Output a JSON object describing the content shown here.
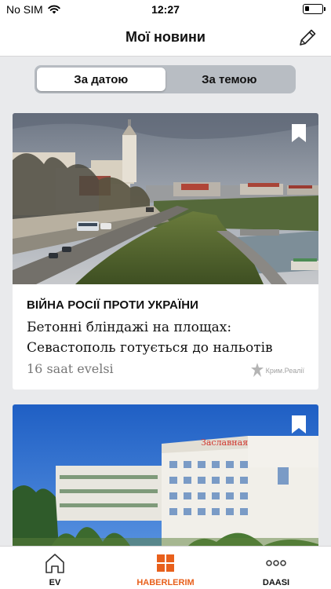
{
  "status_bar": {
    "carrier": "No SIM",
    "time": "12:27"
  },
  "header": {
    "title": "Мої новини",
    "edit_icon": "pencil-icon"
  },
  "segmented": {
    "options": [
      "За датою",
      "За темою"
    ],
    "selected": "За датою"
  },
  "articles": [
    {
      "category": "ВІЙНА РОСІЇ ПРОТИ УКРАЇНИ",
      "headline": "Бетонні бліндажі на площах: Севастополь готується до нальотів",
      "time": "16 saat evelsi",
      "source": "Крим.Реалії",
      "bookmark_icon": "bookmark-icon"
    },
    {
      "sign_text": "Заславная",
      "bookmark_icon": "bookmark-icon"
    }
  ],
  "tab_bar": {
    "tabs": [
      {
        "label": "EV",
        "icon": "home-icon"
      },
      {
        "label": "HABERLERIM",
        "icon": "grid-icon"
      },
      {
        "label": "DAASI",
        "icon": "more-icon"
      }
    ],
    "active": "HABERLERIM",
    "accent_color": "#e8601c"
  }
}
